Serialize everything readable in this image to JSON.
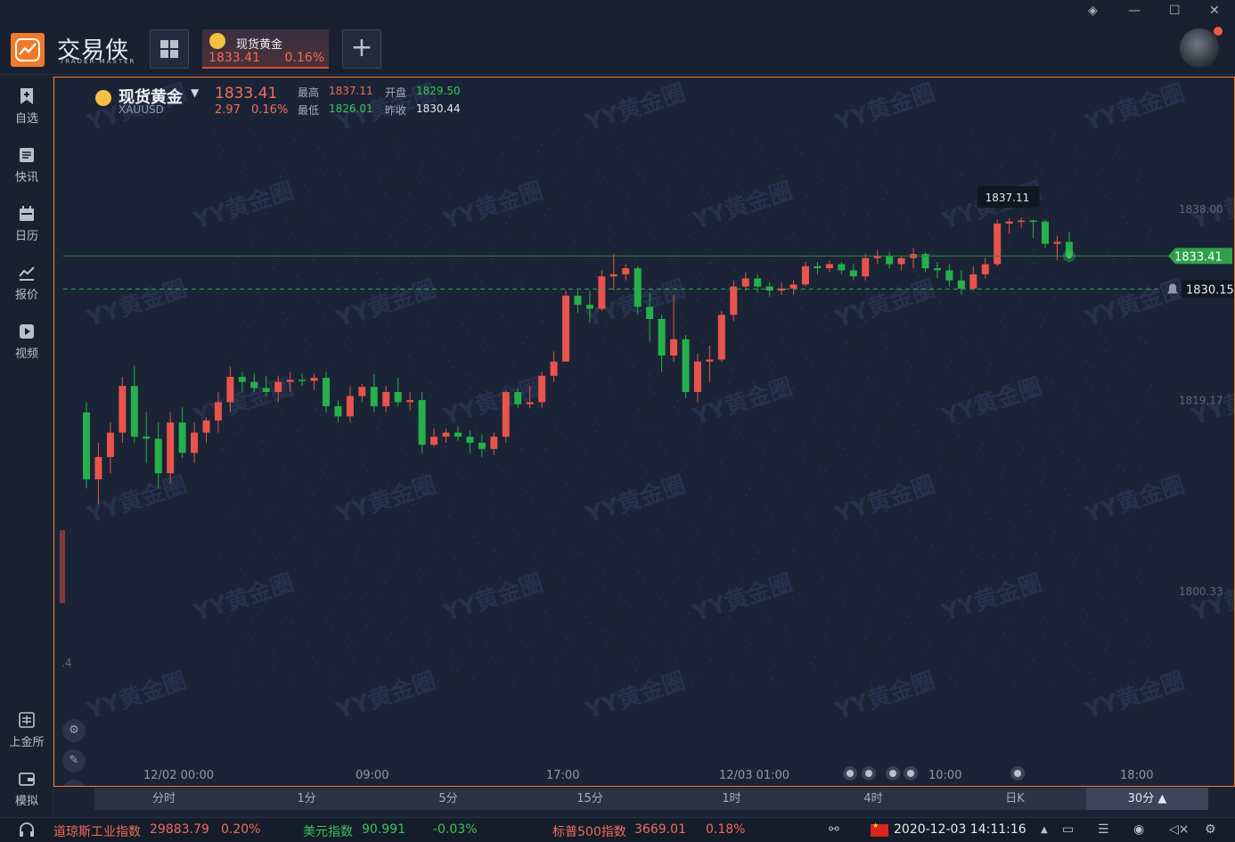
{
  "app": {
    "brand": "交易侠",
    "brand_sub": "TRADER MASTER",
    "window_controls": [
      "layers-icon",
      "minimize-icon",
      "maximize-icon",
      "close-icon"
    ]
  },
  "tabs": [
    {
      "name": "现货黄金",
      "price": "1833.41",
      "pct": "0.16%",
      "active": true
    }
  ],
  "add_tab_label": "+",
  "sidebar": {
    "items": [
      {
        "label": "自选",
        "icon": "bookmark-plus-icon"
      },
      {
        "label": "快讯",
        "icon": "news-icon"
      },
      {
        "label": "日历",
        "icon": "calendar-icon"
      },
      {
        "label": "报价",
        "icon": "chart-line-icon"
      },
      {
        "label": "视频",
        "icon": "play-icon"
      }
    ],
    "bottom_items": [
      {
        "label": "上金所",
        "icon": "sge-icon"
      },
      {
        "label": "模拟",
        "icon": "wallet-icon"
      }
    ]
  },
  "quote": {
    "name": "现货黄金",
    "code": "XAUUSD",
    "price": "1833.41",
    "change": "2.97",
    "change_pct": "0.16%",
    "high_label": "最高",
    "high": "1837.11",
    "open_label": "开盘",
    "open": "1829.50",
    "low_label": "最低",
    "low": "1826.01",
    "prev_label": "昨收",
    "prev": "1830.44"
  },
  "chart_data": {
    "type": "candlestick",
    "y_ticks": [
      "1838.00",
      "1819.17",
      "1800.33"
    ],
    "x_ticks": [
      "12/02 00:00",
      "09:00",
      "17:00",
      "12/03 01:00",
      "10:00",
      "18:00"
    ],
    "current_price_label": "1833.41",
    "prev_close_label": "1830.15",
    "high_marker_label": "1837.11",
    "partial_left_label": ".4",
    "up_color": "#e8544b",
    "down_color": "#26b04a",
    "watermark": "YY黄金圈",
    "ohlc": [
      [
        1818.0,
        1819.0,
        1810.5,
        1811.4
      ],
      [
        1811.4,
        1815.0,
        1809.0,
        1813.6
      ],
      [
        1813.6,
        1817.0,
        1812.0,
        1816.0
      ],
      [
        1816.0,
        1821.5,
        1815.0,
        1820.6
      ],
      [
        1820.6,
        1822.6,
        1815.0,
        1815.6
      ],
      [
        1815.6,
        1818.0,
        1813.0,
        1815.4
      ],
      [
        1815.4,
        1817.0,
        1810.5,
        1812.0
      ],
      [
        1812.0,
        1818.0,
        1811.0,
        1817.0
      ],
      [
        1817.0,
        1818.5,
        1813.5,
        1814.0
      ],
      [
        1814.0,
        1817.0,
        1813.0,
        1816.0
      ],
      [
        1816.0,
        1817.5,
        1815.0,
        1817.2
      ],
      [
        1817.2,
        1820.0,
        1816.0,
        1819.0
      ],
      [
        1819.0,
        1822.5,
        1818.0,
        1821.5
      ],
      [
        1821.5,
        1822.0,
        1820.0,
        1821.0
      ],
      [
        1821.0,
        1821.8,
        1820.0,
        1820.4
      ],
      [
        1820.4,
        1821.6,
        1819.6,
        1820.0
      ],
      [
        1820.0,
        1821.6,
        1819.0,
        1821.0
      ],
      [
        1821.0,
        1822.0,
        1820.0,
        1821.2
      ],
      [
        1821.2,
        1821.8,
        1820.6,
        1821.1
      ],
      [
        1821.1,
        1821.8,
        1820.2,
        1821.4
      ],
      [
        1821.4,
        1822.0,
        1818.0,
        1818.6
      ],
      [
        1818.6,
        1819.2,
        1817.0,
        1817.6
      ],
      [
        1817.6,
        1820.5,
        1817.0,
        1819.6
      ],
      [
        1819.6,
        1820.8,
        1819.0,
        1820.5
      ],
      [
        1820.5,
        1821.8,
        1818.0,
        1818.6
      ],
      [
        1818.6,
        1820.6,
        1818.0,
        1820.0
      ],
      [
        1820.0,
        1821.4,
        1818.6,
        1819.0
      ],
      [
        1819.0,
        1820.0,
        1818.2,
        1819.2
      ],
      [
        1819.2,
        1820.0,
        1814.0,
        1814.8
      ],
      [
        1814.8,
        1816.4,
        1814.6,
        1815.6
      ],
      [
        1815.6,
        1816.4,
        1815.0,
        1816.0
      ],
      [
        1816.0,
        1816.6,
        1815.2,
        1815.6
      ],
      [
        1815.6,
        1816.2,
        1814.0,
        1815.0
      ],
      [
        1815.0,
        1815.8,
        1813.6,
        1814.4
      ],
      [
        1814.4,
        1816.0,
        1813.8,
        1815.6
      ],
      [
        1815.6,
        1820.2,
        1815.0,
        1820.0
      ],
      [
        1820.0,
        1820.4,
        1818.4,
        1818.8
      ],
      [
        1818.8,
        1820.6,
        1818.4,
        1819.0
      ],
      [
        1819.0,
        1822.0,
        1818.4,
        1821.6
      ],
      [
        1821.6,
        1824.0,
        1821.0,
        1823.0
      ],
      [
        1823.0,
        1830.0,
        1823.0,
        1829.5
      ],
      [
        1829.5,
        1830.0,
        1827.8,
        1828.6
      ],
      [
        1828.6,
        1830.0,
        1826.8,
        1828.2
      ],
      [
        1828.2,
        1832.0,
        1828.0,
        1831.4
      ],
      [
        1831.4,
        1833.6,
        1830.0,
        1831.6
      ],
      [
        1831.6,
        1832.6,
        1831.0,
        1832.2
      ],
      [
        1832.2,
        1832.4,
        1827.6,
        1828.4
      ],
      [
        1828.4,
        1829.8,
        1825.0,
        1827.2
      ],
      [
        1827.2,
        1827.6,
        1822.0,
        1823.6
      ],
      [
        1823.6,
        1829.6,
        1823.0,
        1825.2
      ],
      [
        1825.2,
        1825.6,
        1819.4,
        1820.0
      ],
      [
        1820.0,
        1823.8,
        1819.0,
        1823.0
      ],
      [
        1823.0,
        1824.6,
        1821.0,
        1823.2
      ],
      [
        1823.2,
        1828.0,
        1823.0,
        1827.6
      ],
      [
        1827.6,
        1831.0,
        1827.0,
        1830.4
      ],
      [
        1830.4,
        1831.8,
        1830.0,
        1831.2
      ],
      [
        1831.2,
        1831.6,
        1829.8,
        1830.4
      ],
      [
        1830.4,
        1830.8,
        1829.4,
        1830.0
      ],
      [
        1830.0,
        1830.8,
        1829.6,
        1830.2
      ],
      [
        1830.2,
        1831.0,
        1829.6,
        1830.6
      ],
      [
        1830.6,
        1832.8,
        1830.4,
        1832.4
      ],
      [
        1832.4,
        1832.8,
        1831.6,
        1832.2
      ],
      [
        1832.2,
        1833.0,
        1831.8,
        1832.6
      ],
      [
        1832.6,
        1832.8,
        1831.6,
        1832.0
      ],
      [
        1832.0,
        1832.6,
        1831.0,
        1831.4
      ],
      [
        1831.4,
        1833.6,
        1831.0,
        1833.2
      ],
      [
        1833.2,
        1834.0,
        1832.6,
        1833.4
      ],
      [
        1833.4,
        1833.8,
        1832.2,
        1832.6
      ],
      [
        1832.6,
        1833.4,
        1832.0,
        1833.2
      ],
      [
        1833.2,
        1834.2,
        1832.2,
        1833.6
      ],
      [
        1833.6,
        1833.8,
        1831.8,
        1832.2
      ],
      [
        1832.2,
        1832.8,
        1831.2,
        1832.0
      ],
      [
        1832.0,
        1832.6,
        1830.4,
        1831.0
      ],
      [
        1831.0,
        1832.0,
        1829.6,
        1830.2
      ],
      [
        1830.2,
        1832.4,
        1830.0,
        1831.6
      ],
      [
        1831.6,
        1833.2,
        1831.2,
        1832.6
      ],
      [
        1832.6,
        1837.0,
        1832.4,
        1836.6
      ],
      [
        1836.6,
        1837.11,
        1835.6,
        1836.8
      ],
      [
        1836.8,
        1837.2,
        1836.2,
        1836.9
      ],
      [
        1836.9,
        1837.0,
        1835.2,
        1836.8
      ],
      [
        1836.8,
        1837.0,
        1834.2,
        1834.6
      ],
      [
        1834.6,
        1835.4,
        1833.0,
        1834.8
      ],
      [
        1834.8,
        1835.8,
        1833.2,
        1833.41
      ]
    ]
  },
  "periods": [
    "分时",
    "1分",
    "5分",
    "15分",
    "1时",
    "4时",
    "日K",
    "30分"
  ],
  "active_period": "30分",
  "status": {
    "items": [
      {
        "name": "道琼斯工业指数",
        "value": "29883.79",
        "pct": "0.20%",
        "color": "#f06b5b"
      },
      {
        "name": "美元指数",
        "value": "90.991",
        "pct": "-0.03%",
        "color": "#3cc35a"
      },
      {
        "name": "标普500指数",
        "value": "3669.01",
        "pct": "0.18%",
        "color": "#f06b5b"
      }
    ],
    "datetime": "2020-12-03 14:11:16"
  }
}
